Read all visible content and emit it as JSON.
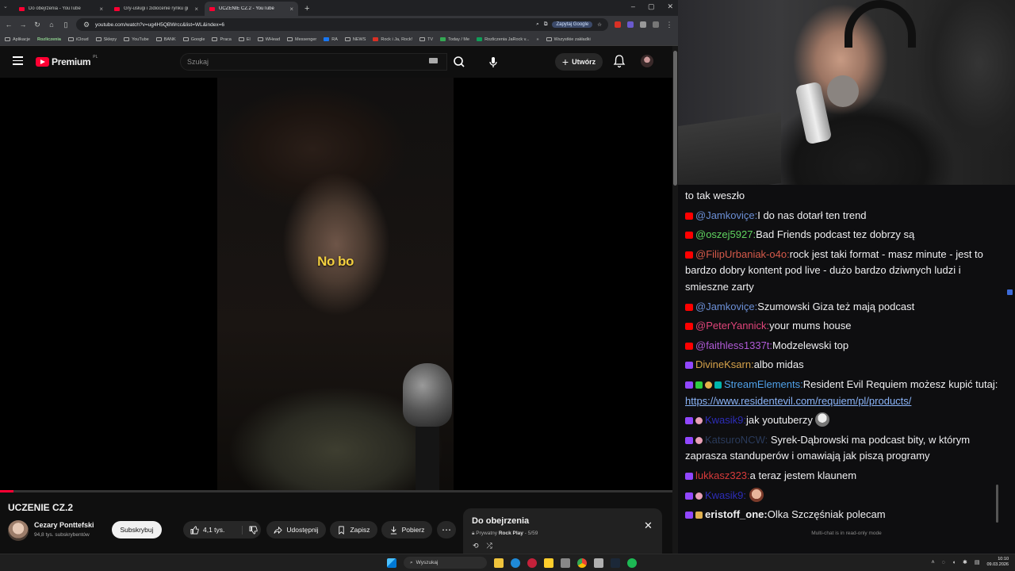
{
  "browser": {
    "tabs": [
      {
        "label": "Do obejrzenia - YouTube",
        "active": false
      },
      {
        "label": "Gry-usługi i zidiocenie rynku gi",
        "active": false
      },
      {
        "label": "UCZENIE CZ.2 - YouTube",
        "active": true
      }
    ],
    "new_tab": "+",
    "url": "youtube.com/watch?v=ug4H5QBWrcc&list=WL&index=6",
    "google_button": "Zapytaj Google",
    "bookmarks": [
      "Aplikacje",
      "Rozliczenia",
      "iCloud",
      "Sklepy",
      "YouTube",
      "BANK",
      "Google",
      "Praca",
      "El",
      "WHead",
      "Messenger",
      "RA",
      "NEWS",
      "Rock i Ja, Rock!",
      "TV",
      "Today / Me",
      "Rozliczenia JaRock v..."
    ],
    "all_bookmarks": "Wszystkie zakładki"
  },
  "youtube": {
    "logo": "Premium",
    "logo_region": "PL",
    "search_placeholder": "Szukaj",
    "create_label": "Utwórz",
    "subtitle": "No bo",
    "progress": 0.02,
    "video_title": "UCZENIE CZ.2",
    "channel_name": "Cezary Ponttefski",
    "channel_subs": "94,8 tys. subskrybentów",
    "subscribe_label": "Subskrybuj",
    "likes": "4,1 tys.",
    "share_label": "Udostępnij",
    "save_label": "Zapisz",
    "download_label": "Pobierz",
    "queue": {
      "title": "Do obejrzenia",
      "private": "Prywatny",
      "owner": "Rock Play",
      "position": "5/59"
    }
  },
  "chat": {
    "top_line": "to tak weszło",
    "messages": [
      {
        "platform": "yt",
        "user": "@Jamkoviçe:",
        "color": "#6b8fd6",
        "text": "I do nas dotarł ten trend"
      },
      {
        "platform": "yt",
        "user": "@oszej5927:",
        "color": "#5fd35f",
        "text": "Bad Friends podcast tez dobrzy są"
      },
      {
        "platform": "yt",
        "user": "@FilipUrbaniak-o4o:",
        "color": "#d65a4a",
        "text": "rock jest taki format - masz minute - jest to bardzo dobry kontent pod live - dużo bardzo dziwnych ludzi i smieszne zarty"
      },
      {
        "platform": "yt",
        "user": "@Jamkoviçe:",
        "color": "#6b8fd6",
        "text": "Szumowski Giza też mają podcast"
      },
      {
        "platform": "yt",
        "user": "@PeterYannick:",
        "color": "#e0457a",
        "text": "your mums house"
      },
      {
        "platform": "yt",
        "user": "@faithless1337t:",
        "color": "#b05ad6",
        "text": "Modzelewski top"
      },
      {
        "platform": "tw",
        "user": "DivineKsarn:",
        "color": "#d6a24a",
        "text": "albo midas"
      },
      {
        "platform": "tw",
        "user": "StreamElements:",
        "color": "#4fa0e8",
        "text": "Resident Evil Requiem możesz kupić tutaj:",
        "link": "https://www.residentevil.com/requiem/pl/products/"
      },
      {
        "platform": "tw",
        "user": "Kwasik9:",
        "color": "#2d2db8",
        "text": "jak youtuberzy"
      },
      {
        "platform": "tw",
        "user": "KatsuroNCW:",
        "color": "#2a3a5a",
        "text": "Syrek-Dąbrowski ma podcast bity, w którym zaprasza standuperów i omawiają jak piszą programy"
      },
      {
        "platform": "tw",
        "user": "lukkasz323:",
        "color": "#d63a3a",
        "text": "a teraz jestem klaunem"
      },
      {
        "platform": "tw",
        "user": "Kwasik9:",
        "color": "#2d2db8",
        "text": ""
      },
      {
        "platform": "tw",
        "user": "eristoff_one:",
        "color": "#efeff1",
        "text": "Olka Szczęśniak polecam"
      }
    ],
    "footer": "Multi-chat is in read-only mode"
  },
  "taskbar": {
    "search_placeholder": "Wyszukaj",
    "time": "10:10",
    "date": "09.03.2026"
  }
}
